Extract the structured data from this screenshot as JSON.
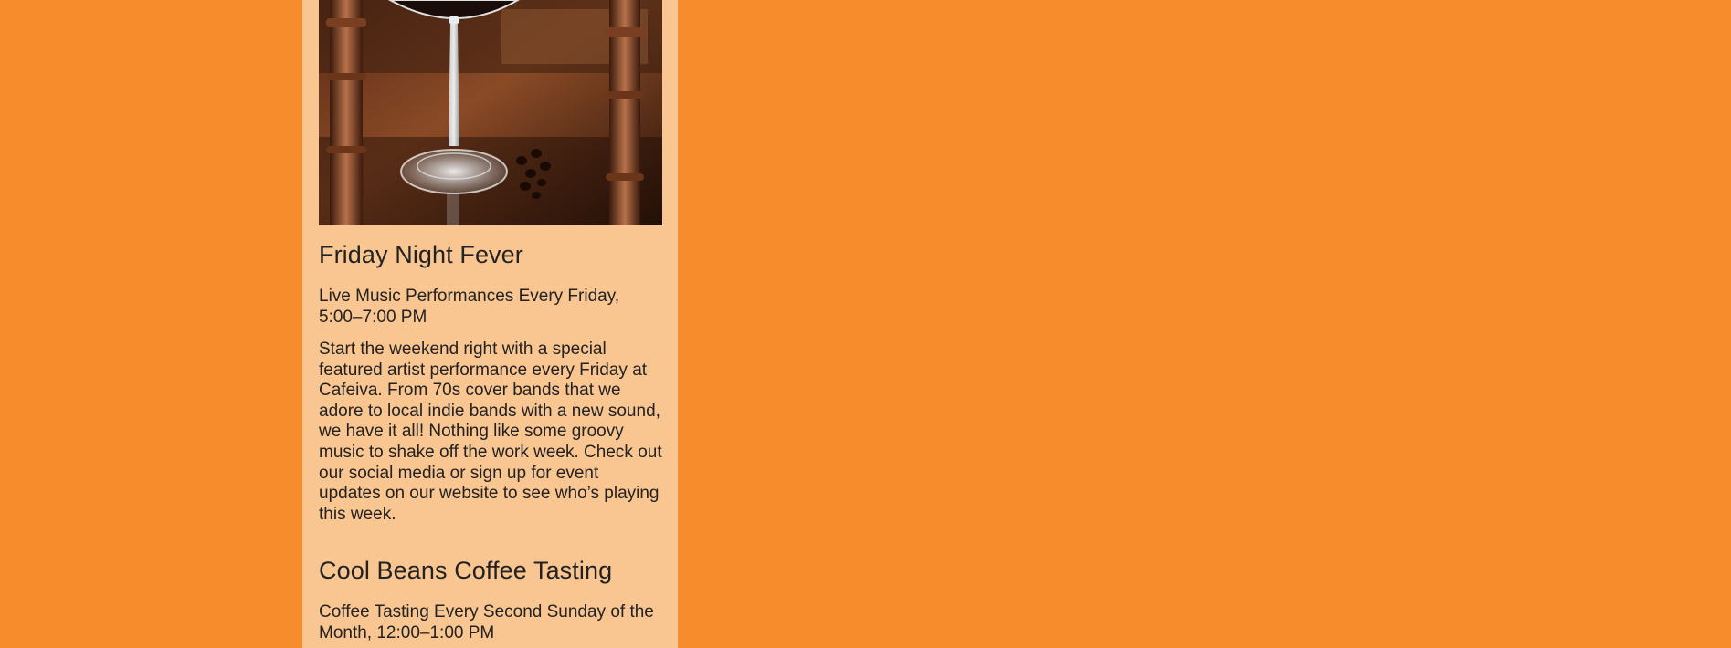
{
  "image": {
    "alt": "Wine glass of coffee on a wooden table with coffee beans",
    "icon": "coffee-wine-glass-photo"
  },
  "events": [
    {
      "title": "Friday Night Fever",
      "subtitle": "Live Music Performances Every Friday, 5:00–7:00 PM",
      "description": "Start the weekend right with a special featured artist performance every Friday at Cafeiva. From 70s cover bands that we adore to local indie bands with a new sound, we have it all! Nothing like some groovy music to shake off the work week. Check out our social media or sign up for event updates on our website to see who’s playing this week."
    },
    {
      "title": "Cool Beans Coffee Tasting",
      "subtitle": "Coffee Tasting Every Second Sunday of the Month, 12:00–1:00 PM"
    }
  ],
  "colors": {
    "page_background": "#f78c2c",
    "card_background": "#f9c591",
    "text": "#222222"
  }
}
